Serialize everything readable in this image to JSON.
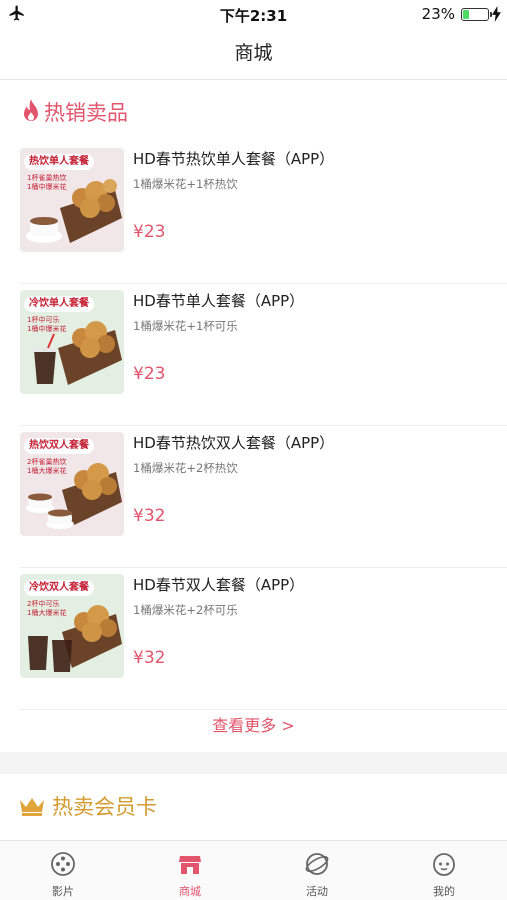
{
  "status_bar": {
    "time": "下午2:31",
    "battery": "23%",
    "battery_level": 0.23
  },
  "nav": {
    "title": "商城"
  },
  "hot_section": {
    "title": "热销卖品"
  },
  "products": [
    {
      "name": "HD春节热饮单人套餐（APP）",
      "desc": "1桶爆米花+1杯热饮",
      "price": "¥23",
      "thumb": {
        "tag": "热饮单人套餐",
        "line1": "1杯雀巢热饮",
        "line2": "1桶中爆米花",
        "bg": "#f1e6e8"
      }
    },
    {
      "name": "HD春节单人套餐（APP）",
      "desc": "1桶爆米花+1杯可乐",
      "price": "¥23",
      "thumb": {
        "tag": "冷饮单人套餐",
        "line1": "1杯中可乐",
        "line2": "1桶中爆米花",
        "bg": "#e3efe2"
      }
    },
    {
      "name": "HD春节热饮双人套餐（APP）",
      "desc": "1桶爆米花+2杯热饮",
      "price": "¥32",
      "thumb": {
        "tag": "热饮双人套餐",
        "line1": "2杯雀巢热饮",
        "line2": "1桶大爆米花",
        "bg": "#f1e6e8"
      }
    },
    {
      "name": "HD春节双人套餐（APP）",
      "desc": "1桶爆米花+2杯可乐",
      "price": "¥32",
      "thumb": {
        "tag": "冷饮双人套餐",
        "line1": "2杯中可乐",
        "line2": "1桶大爆米花",
        "bg": "#e3efe2"
      }
    }
  ],
  "see_more": "查看更多 >",
  "member_section": {
    "title": "热卖会员卡"
  },
  "tabs": [
    {
      "label": "影片",
      "icon": "film-reel-icon"
    },
    {
      "label": "商城",
      "icon": "store-icon",
      "active": true
    },
    {
      "label": "活动",
      "icon": "planet-icon"
    },
    {
      "label": "我的",
      "icon": "profile-face-icon"
    }
  ],
  "colors": {
    "accent": "#e2556d",
    "gold": "#d59a2f"
  }
}
